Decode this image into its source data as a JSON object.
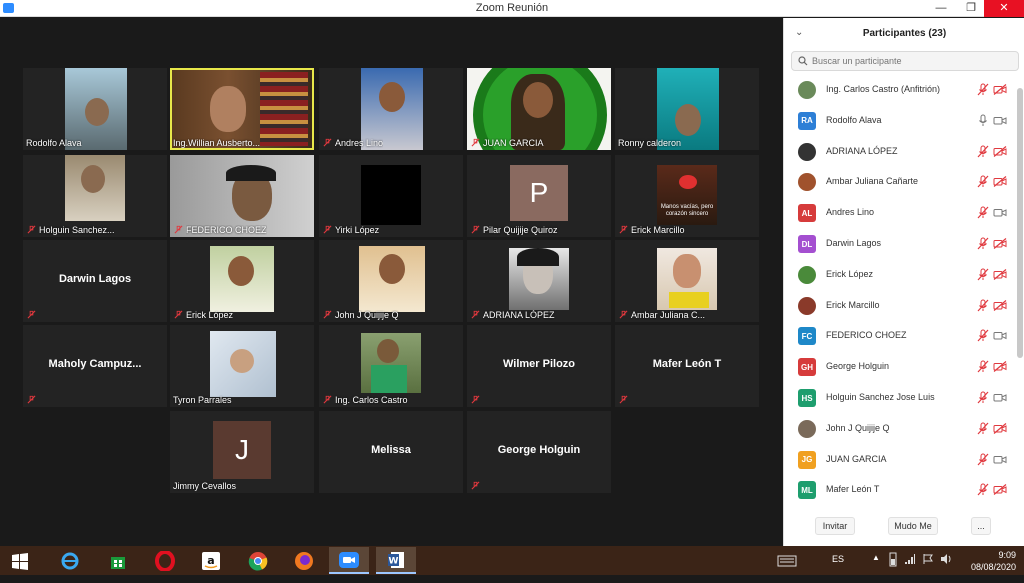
{
  "window": {
    "title": "Zoom Reunión",
    "minimize": "—",
    "restore": "❐",
    "close": "✕"
  },
  "gallery": {
    "tiles": [
      {
        "name": "Rodolfo Alava",
        "muted": false
      },
      {
        "name": "Ing.Willian Ausberto...",
        "muted": false
      },
      {
        "name": "Andres Lino",
        "muted": true
      },
      {
        "name": "JUAN GARCIA",
        "muted": true
      },
      {
        "name": "Ronny calderon",
        "muted": false
      },
      {
        "name": "Holguin Sanchez...",
        "muted": true
      },
      {
        "name": "FEDERICO CHOEZ",
        "muted": true
      },
      {
        "name": "Yirki López",
        "muted": true
      },
      {
        "name": "Pilar Quijije Quiroz",
        "muted": true,
        "avatar_letter": "P"
      },
      {
        "name": "Erick Marcillo",
        "muted": true,
        "image_text": "Manos vacías, pero corazón sincero"
      },
      {
        "name": "Darwin Lagos",
        "muted": true,
        "video_off": true
      },
      {
        "name": "Erick López",
        "muted": true
      },
      {
        "name": "John J Quijije Q",
        "muted": true
      },
      {
        "name": "ADRIANA LÓPEZ",
        "muted": true
      },
      {
        "name": "Ambar Juliana C...",
        "muted": true
      },
      {
        "name": "Maholy Campuz...",
        "muted": true,
        "video_off": true
      },
      {
        "name": "Tyron Parrales",
        "muted": false
      },
      {
        "name": "Ing. Carlos Castro",
        "muted": true
      },
      {
        "name": "Wilmer Pilozo",
        "muted": true,
        "video_off": true
      },
      {
        "name": "Mafer León T",
        "muted": true,
        "video_off": true
      },
      {
        "name": "Jimmy Cevallos",
        "muted": false,
        "avatar_letter": "J"
      },
      {
        "name": "Melissa",
        "muted": false,
        "video_off": true
      },
      {
        "name": "George Holguin",
        "muted": true,
        "video_off": true
      }
    ]
  },
  "participants_panel": {
    "title": "Participantes (23)",
    "search_placeholder": "Buscar un participante",
    "participants": [
      {
        "name": "Ing. Carlos Castro (Anfitrión)",
        "initials": "",
        "color": "#6a8a5a",
        "photo": true,
        "mic_muted": true,
        "cam_off": true
      },
      {
        "name": "Rodolfo Alava",
        "initials": "RA",
        "color": "#2d7fd6",
        "photo": false,
        "mic_muted": false,
        "cam_off": false
      },
      {
        "name": "ADRIANA LÓPEZ",
        "initials": "",
        "color": "#333333",
        "photo": true,
        "mic_muted": true,
        "cam_off": true
      },
      {
        "name": "Ambar Juliana Cañarte",
        "initials": "",
        "color": "#a0522d",
        "photo": true,
        "mic_muted": true,
        "cam_off": true
      },
      {
        "name": "Andres Lino",
        "initials": "AL",
        "color": "#d63b3b",
        "photo": false,
        "mic_muted": true,
        "cam_off": false
      },
      {
        "name": "Darwin Lagos",
        "initials": "DL",
        "color": "#a44fd0",
        "photo": false,
        "mic_muted": true,
        "cam_off": true
      },
      {
        "name": "Erick López",
        "initials": "",
        "color": "#4a8a3a",
        "photo": true,
        "mic_muted": true,
        "cam_off": true
      },
      {
        "name": "Erick Marcillo",
        "initials": "",
        "color": "#8a3a2a",
        "photo": true,
        "mic_muted": true,
        "cam_off": true
      },
      {
        "name": "FEDERICO CHOEZ",
        "initials": "FC",
        "color": "#1e88c8",
        "photo": false,
        "mic_muted": true,
        "cam_off": false
      },
      {
        "name": "George Holguin",
        "initials": "GH",
        "color": "#d63b3b",
        "photo": false,
        "mic_muted": true,
        "cam_off": true
      },
      {
        "name": "Holguin Sanchez Jose Luis",
        "initials": "HS",
        "color": "#1e9e6e",
        "photo": false,
        "mic_muted": true,
        "cam_off": false
      },
      {
        "name": "John J Quijije Q",
        "initials": "",
        "color": "#7a6a5a",
        "photo": true,
        "mic_muted": true,
        "cam_off": true
      },
      {
        "name": "JUAN GARCIA",
        "initials": "JG",
        "color": "#f0a020",
        "photo": false,
        "mic_muted": true,
        "cam_off": false
      },
      {
        "name": "Mafer León T",
        "initials": "ML",
        "color": "#1e9e6e",
        "photo": false,
        "mic_muted": true,
        "cam_off": true
      }
    ],
    "footer": {
      "invite": "Invitar",
      "mute_me": "Mudo Me",
      "more": "..."
    }
  },
  "taskbar": {
    "language": "ES",
    "time": "9:09",
    "date": "08/08/2020",
    "apps": [
      "windows-start-icon",
      "internet-explorer-icon",
      "store-icon",
      "opera-icon",
      "amazon-icon",
      "chrome-icon",
      "firefox-icon",
      "zoom-icon",
      "word-icon"
    ]
  },
  "colors": {
    "muted_red": "#e0383e",
    "active_speaker": "#e8e84a",
    "accent": "#2d8cff"
  }
}
